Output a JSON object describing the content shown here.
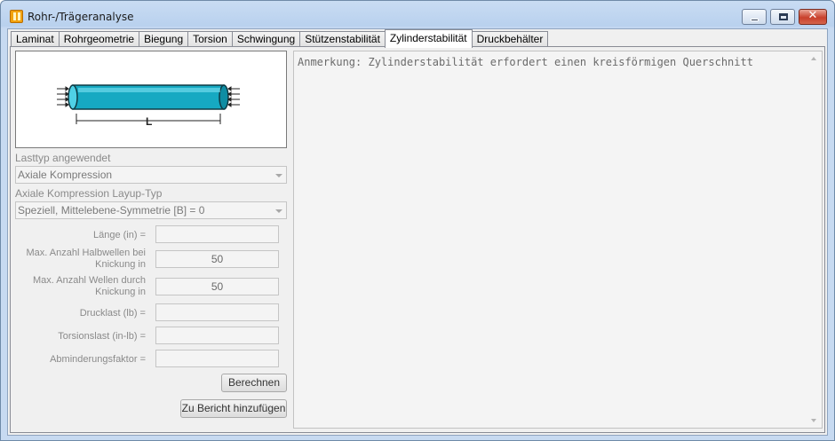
{
  "window": {
    "title": "Rohr-/Trägeranalyse",
    "icon": "app-logo-icon",
    "controls": {
      "minimize": "minimize-icon",
      "maximize": "maximize-icon",
      "close_glyph": "✕"
    }
  },
  "tabs": [
    {
      "label": "Laminat",
      "active": false
    },
    {
      "label": "Rohrgeometrie",
      "active": false
    },
    {
      "label": "Biegung",
      "active": false
    },
    {
      "label": "Torsion",
      "active": false
    },
    {
      "label": "Schwingung",
      "active": false
    },
    {
      "label": "Stützenstabilität",
      "active": false
    },
    {
      "label": "Zylinderstabilität",
      "active": true
    },
    {
      "label": "Druckbehälter",
      "active": false
    }
  ],
  "diagram": {
    "length_label": "L",
    "tube_color": "#16a9c2",
    "arrows": "←"
  },
  "form": {
    "load_type": {
      "label": "Lasttyp angewendet",
      "value": "Axiale Kompression"
    },
    "layup_type": {
      "label": "Axiale Kompression Layup-Typ",
      "value": "Speziell, Mittelebene-Symmetrie [B] = 0"
    },
    "fields": [
      {
        "label": "Länge (in) =",
        "value": ""
      },
      {
        "label": "Max. Anzahl Halbwellen bei Knickung in",
        "value": "50"
      },
      {
        "label": "Max. Anzahl Wellen durch Knickung in",
        "value": "50"
      },
      {
        "label": "Drucklast (lb) =",
        "value": ""
      },
      {
        "label": "Torsionslast (in-lb) =",
        "value": ""
      },
      {
        "label": "Abminderungsfaktor =",
        "value": ""
      }
    ],
    "calculate_button": "Berechnen",
    "add_report_button": "Zu Bericht hinzufügen"
  },
  "notes": {
    "text": "Anmerkung: Zylinderstabilität erfordert einen kreisförmigen Querschnitt"
  }
}
